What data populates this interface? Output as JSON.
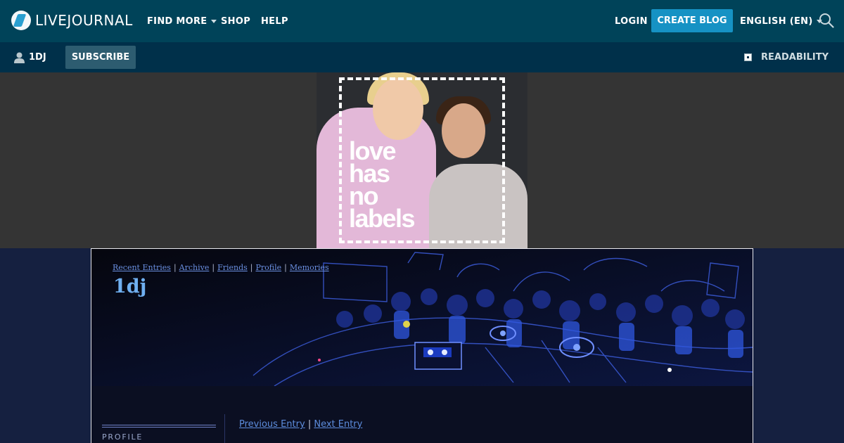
{
  "topbar": {
    "brand": "LIVEJOURNAL",
    "nav": [
      "FIND MORE",
      "SHOP",
      "HELP"
    ],
    "login": "LOGIN",
    "create_blog": "CREATE BLOG",
    "language": "ENGLISH (EN)"
  },
  "subbar": {
    "username": "1DJ",
    "subscribe": "SUBSCRIBE",
    "readability": "READABILITY"
  },
  "ad": {
    "lines": [
      "love",
      "has",
      "no",
      "labels"
    ]
  },
  "journal": {
    "nav": [
      "Recent Entries",
      "Archive",
      "Friends",
      "Profile",
      "Memories"
    ],
    "title": "1dj",
    "profile_label": "PROFILE",
    "prev_entry": "Previous Entry",
    "next_entry": "Next Entry",
    "separator": "|"
  },
  "colors": {
    "topbar": "#004359",
    "subbar": "#00304a",
    "create_button": "#1692c4",
    "link": "#6a8fe0",
    "title": "#6faff0"
  }
}
